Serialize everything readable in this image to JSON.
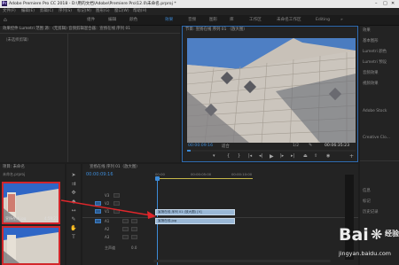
{
  "window": {
    "app_icon": "Pr",
    "title": "Adobe Premiere Pro CC 2018 - D:\\用的文档\\Adobe\\Premiere Pro\\12.0\\未命名.prproj *"
  },
  "menu": [
    "文件(F)",
    "编辑(E)",
    "剪辑(C)",
    "序列(S)",
    "标记(M)",
    "图形(G)",
    "窗口(W)",
    "帮助(H)"
  ],
  "workspace_tabs": [
    {
      "label": "组件"
    },
    {
      "label": "编辑"
    },
    {
      "label": "颜色"
    },
    {
      "label": "效果",
      "active": true
    },
    {
      "label": "音频"
    },
    {
      "label": "图形"
    },
    {
      "label": "库"
    },
    {
      "label": "工作区"
    },
    {
      "label": "未命名工作区"
    },
    {
      "label": "Editing"
    }
  ],
  "source_panel": {
    "tabs": "效果控件  Lumetri 范围  源：(无剪辑)  音频剪辑混合器：宣扬在线  序列 01",
    "no_clip": "（未选择剪辑）"
  },
  "program_monitor": {
    "title": "节目: 宣扬在线 序列 01 （放大图）",
    "timecode_left": "00:00:09:16",
    "fit": "适合",
    "ratio": "1/2",
    "timecode_right": "00:06:35:23"
  },
  "right_panel": {
    "items": [
      "效果",
      "基本图形",
      "Lumetri 颜色",
      "Lumetri 预设",
      "音频效果",
      "视频效果",
      "Adobe Stock",
      "信息",
      "标记",
      "历史记录",
      "Creative Clo..."
    ]
  },
  "project_panel": {
    "title": "项目: 未命名",
    "file": "未命名.prproj",
    "clip1_name": "宣扬在线.jpg",
    "clip1_duration": "4:59:21",
    "clip2_name": "宣扬在线 序列..."
  },
  "timeline": {
    "title": "宣扬在线 序列 01（放大图）",
    "timecode": "00:00:09:16",
    "ruler": [
      "00:00",
      "00:00:05:00",
      "00:00:10:00"
    ],
    "tracks": [
      {
        "name": "V3"
      },
      {
        "name": "V2"
      },
      {
        "name": "V1"
      },
      {
        "name": "A1"
      },
      {
        "name": "A2"
      },
      {
        "name": "A3"
      },
      {
        "name": "主声道"
      }
    ],
    "clip_v2": "宣扬在线 序列 01 (放大图) [V]",
    "clip_v1": "宣扬在线.jpg",
    "master_value": "0.0"
  },
  "watermark": {
    "text": "Bai",
    "text2": "经验",
    "url": "jingyan.baidu.com"
  }
}
